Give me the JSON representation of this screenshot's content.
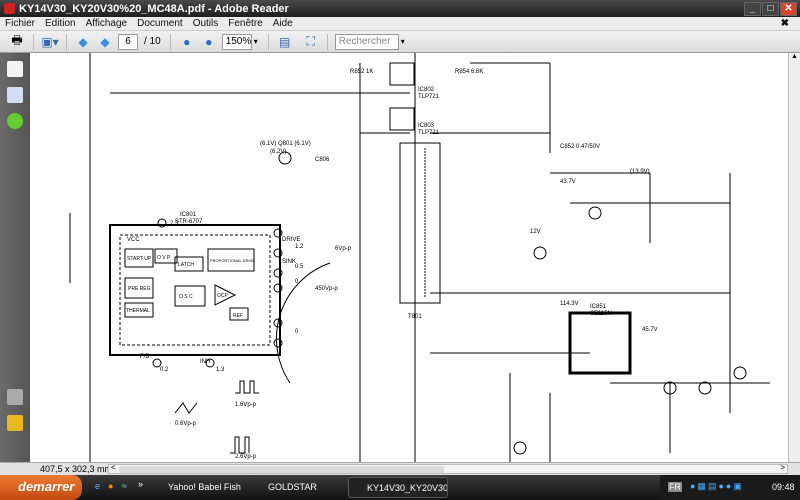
{
  "window": {
    "title": "KY14V30_KY20V30%20_MC48A.pdf - Adobe Reader",
    "minimize": "_",
    "maximize": "□",
    "close": "✕"
  },
  "menu": [
    "Fichier",
    "Edition",
    "Affichage",
    "Document",
    "Outils",
    "Fenêtre",
    "Aide"
  ],
  "menu_close": "✖",
  "toolbar": {
    "page_current": "6",
    "page_total": "/ 10",
    "zoom": "150%",
    "search_placeholder": "Rechercher"
  },
  "statusbar": {
    "page_size": "407,5 x 302,3 mm"
  },
  "taskbar": {
    "start": "demarrer",
    "quicklaunch_more": "»",
    "tasks": [
      "Yahoo! Babel Fish - T...",
      "GOLDSTAR",
      "KY14V30_KY20V30%..."
    ],
    "lang": "FR",
    "clock": "09:48"
  },
  "schematic": {
    "ic801": "IC801",
    "ic801_part": "STR-6707",
    "vcc": "VCC",
    "start_up": "START UP",
    "ovp": "O V P",
    "latch": "LATCH",
    "prop_drive": "PROPORTIONAL DRIVE",
    "pre_reg": "PRE REG",
    "thermal": "THERMAL",
    "osc": "O S C",
    "ocp": "OCP",
    "ref": "REF",
    "drive": "DRIVE",
    "sink": "SINK",
    "fb": "F/B",
    "inh": "INH",
    "ic802": "IC802",
    "ic802_part": "TLP721",
    "ic803": "IC803",
    "ic803_part": "TLP721",
    "ic851": "IC851",
    "ic851_part": "SE115N",
    "t801": "T801",
    "q801": "(6.1V) Q801 (6.1V)",
    "c806": "C806",
    "r852": "R852 1K",
    "r854": "R854 6.8K",
    "c852": "C852 0.47/50V",
    "pin_vals": [
      "2.3",
      "0.2",
      "1.3",
      "1.2",
      "0.5",
      "0",
      "0"
    ],
    "wave1": "1.6Vp-p",
    "wave2": "0.6Vp-p",
    "wave3": "2.6Vp-p",
    "wave4": "6Vp-p",
    "wave5": "450Vp-p",
    "v1": "43.7V",
    "v2": "114.3V",
    "v3": "45.7V",
    "v4": "(6.2V)",
    "v5": "12V",
    "v6": "(13.9V)"
  }
}
